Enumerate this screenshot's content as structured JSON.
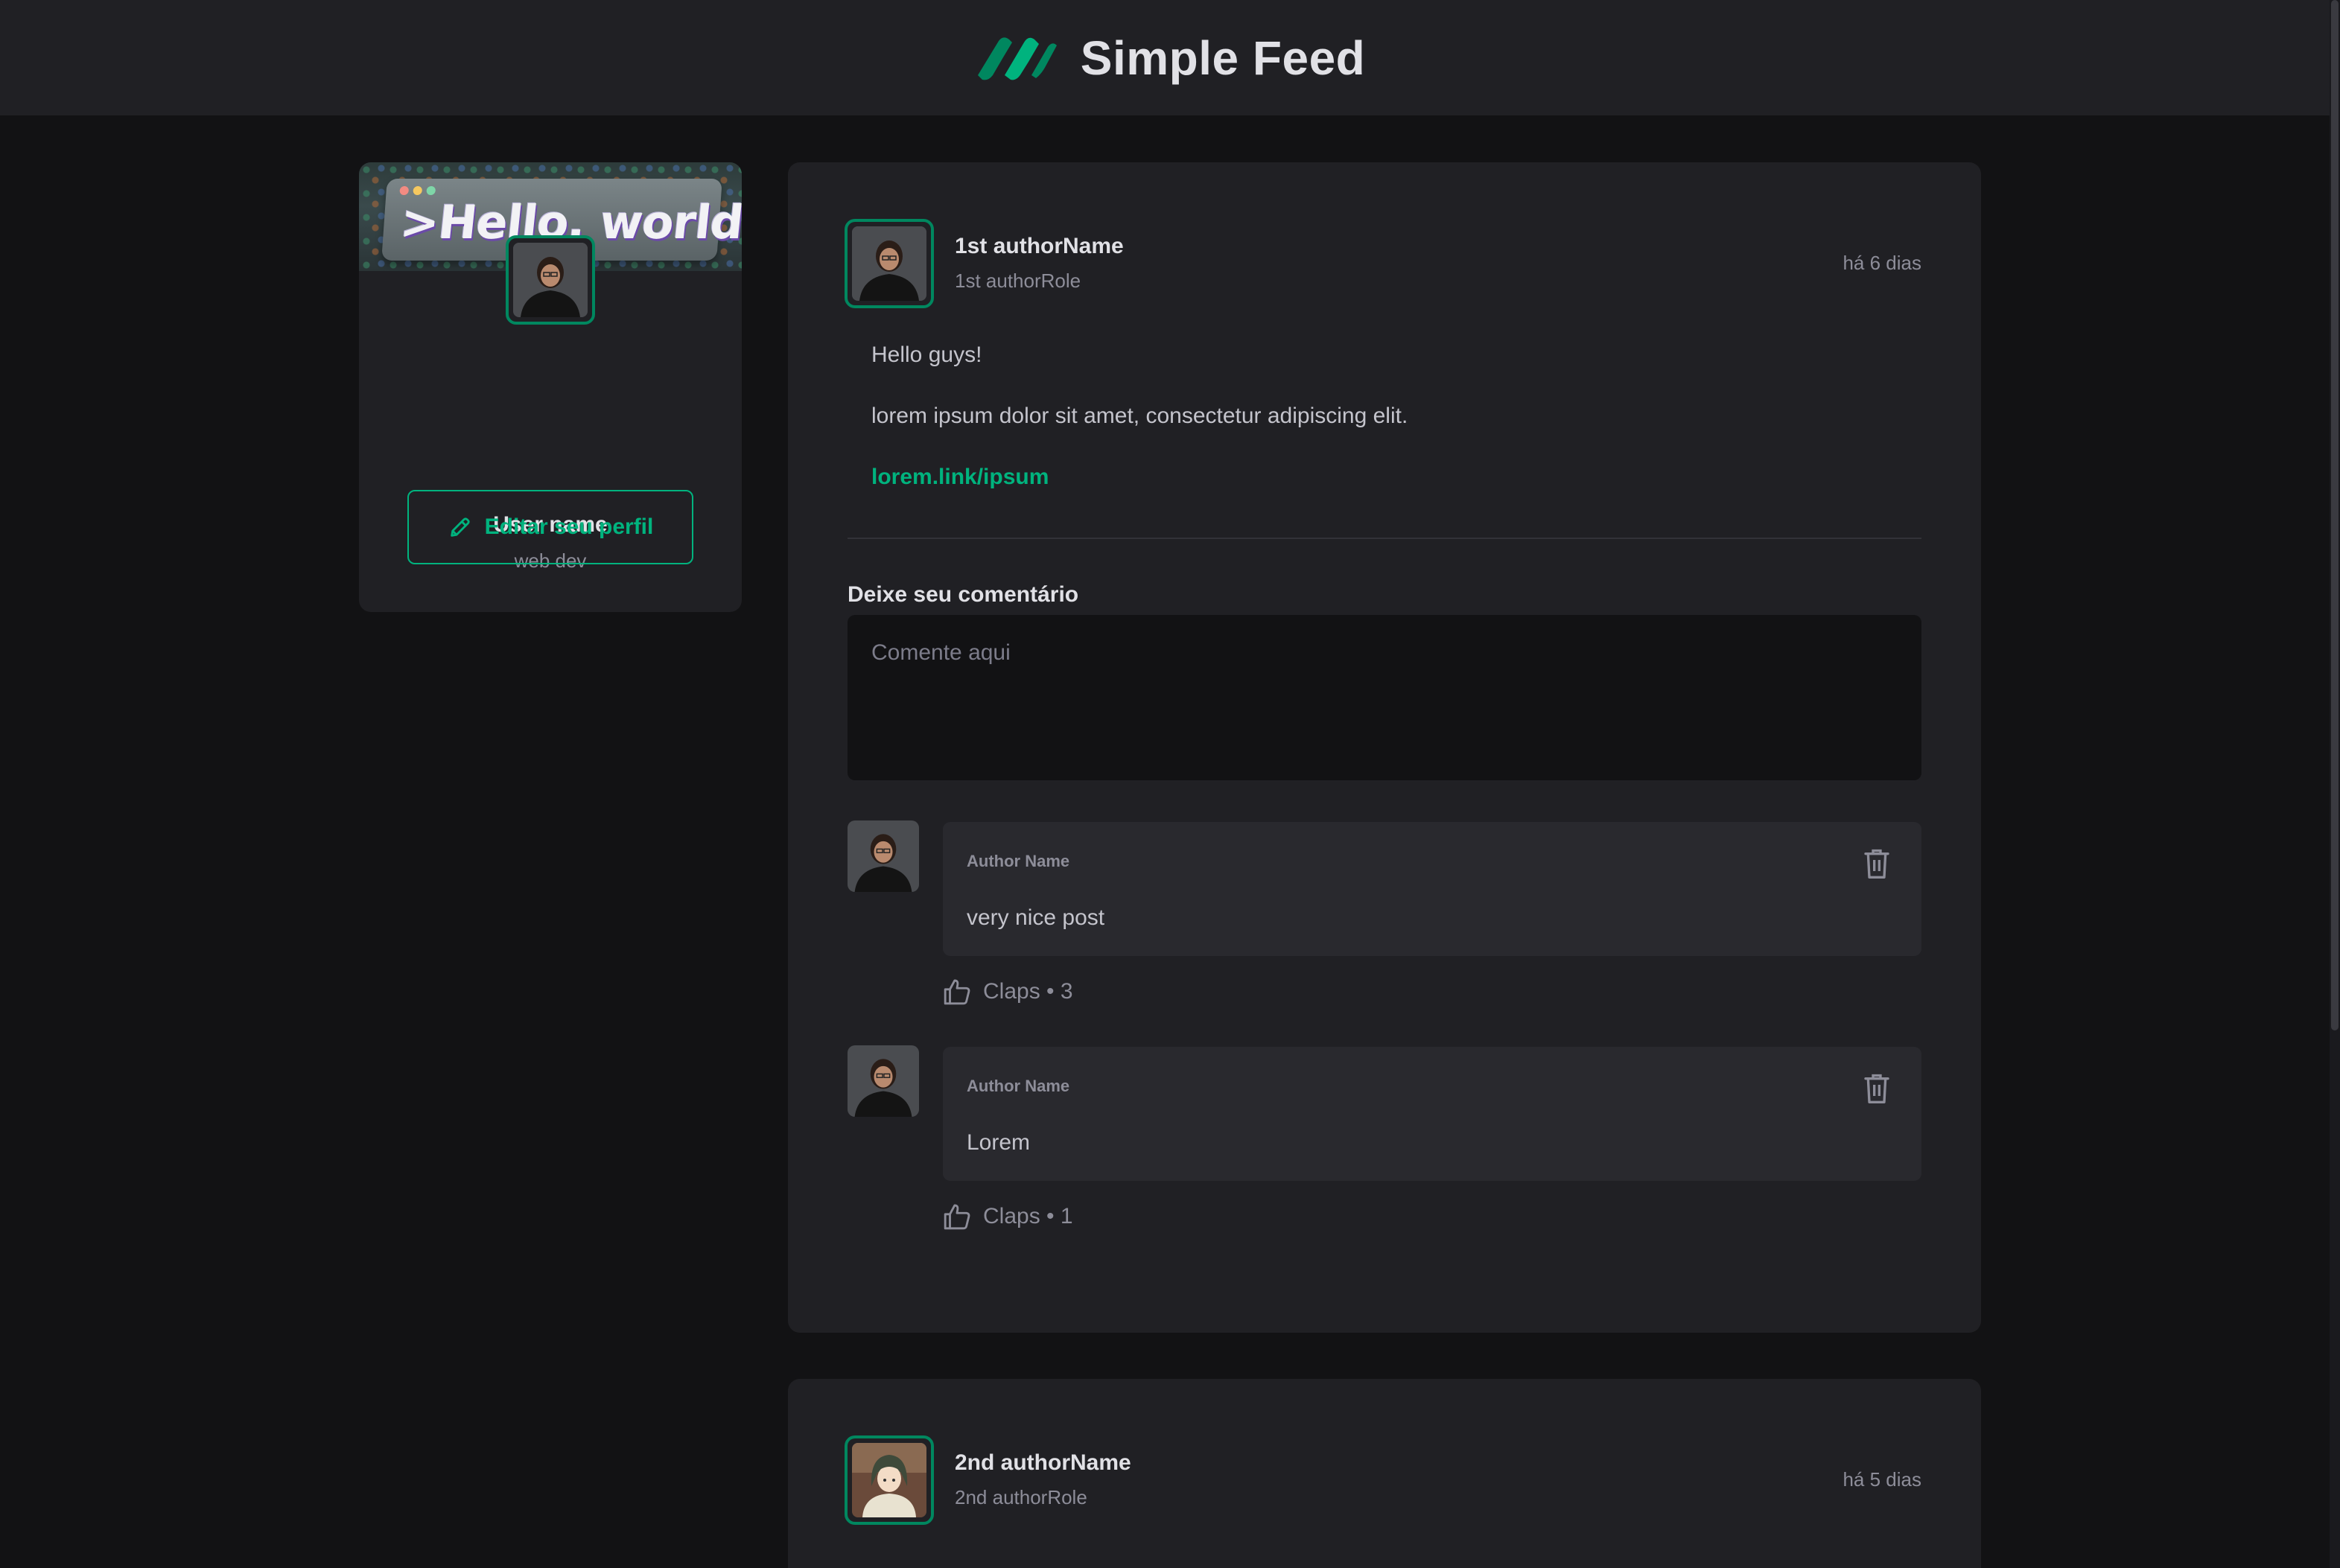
{
  "header": {
    "title": "Simple Feed"
  },
  "sidebar": {
    "cover_text": ">Hello, world!_",
    "user_name": "User name",
    "user_role": "web dev",
    "edit_button_label": "Editar seu perfil"
  },
  "posts": [
    {
      "author_name": "1st authorName",
      "author_role": "1st authorRole",
      "time": "há 6 dias",
      "paragraphs": [
        "Hello guys!",
        "lorem ipsum dolor sit amet, consectetur adipiscing elit."
      ],
      "link": "lorem.link/ipsum",
      "comment_heading": "Deixe seu comentário",
      "comment_placeholder": "Comente aqui",
      "comments": [
        {
          "author": "Author Name",
          "text": "very nice post",
          "claps_label": "Claps • 3"
        },
        {
          "author": "Author Name",
          "text": "Lorem",
          "claps_label": "Claps • 1"
        }
      ]
    },
    {
      "author_name": "2nd authorName",
      "author_role": "2nd authorRole",
      "time": "há 5 dias"
    }
  ],
  "colors": {
    "accent": "#00b37e",
    "accent_dark": "#00875f",
    "background": "#121214",
    "surface": "#202024",
    "comment_surface": "#29292e"
  },
  "icons": {
    "logo": "ignite-logo-icon",
    "edit": "pencil-icon",
    "delete": "trash-icon",
    "claps": "thumbs-up-icon"
  }
}
